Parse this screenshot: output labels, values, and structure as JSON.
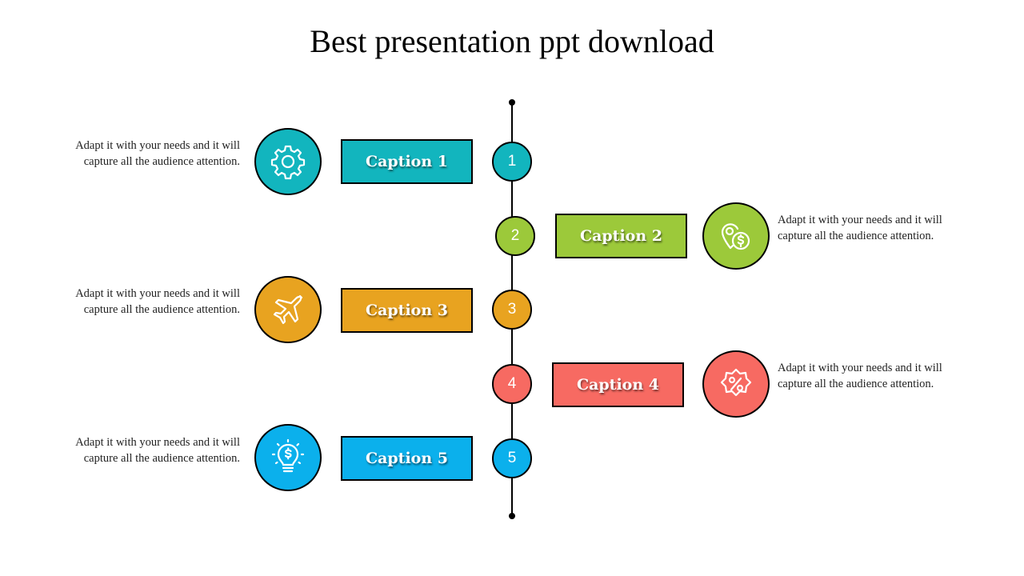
{
  "title": "Best presentation ppt download",
  "colors": {
    "teal": "#12B5BE",
    "green": "#9CC93A",
    "orange": "#E8A320",
    "red": "#F76A62",
    "blue": "#0BB0EC"
  },
  "steps": [
    {
      "number": "1",
      "caption": "Caption 1",
      "icon": "gear-icon",
      "color": "#12B5BE",
      "side": "left",
      "description": "Adapt it with your needs and it will capture all the audience attention."
    },
    {
      "number": "2",
      "caption": "Caption 2",
      "icon": "location-dollar-icon",
      "color": "#9CC93A",
      "side": "right",
      "description": "Adapt it with your needs and it will capture all the audience attention."
    },
    {
      "number": "3",
      "caption": "Caption 3",
      "icon": "airplane-icon",
      "color": "#E8A320",
      "side": "left",
      "description": "Adapt it with your needs and it will capture all the audience attention."
    },
    {
      "number": "4",
      "caption": "Caption 4",
      "icon": "discount-badge-icon",
      "color": "#F76A62",
      "side": "right",
      "description": "Adapt it with your needs and it will capture all the audience attention."
    },
    {
      "number": "5",
      "caption": "Caption 5",
      "icon": "lightbulb-dollar-icon",
      "color": "#0BB0EC",
      "side": "left",
      "description": "Adapt it with your needs and it will capture all the audience attention."
    }
  ]
}
